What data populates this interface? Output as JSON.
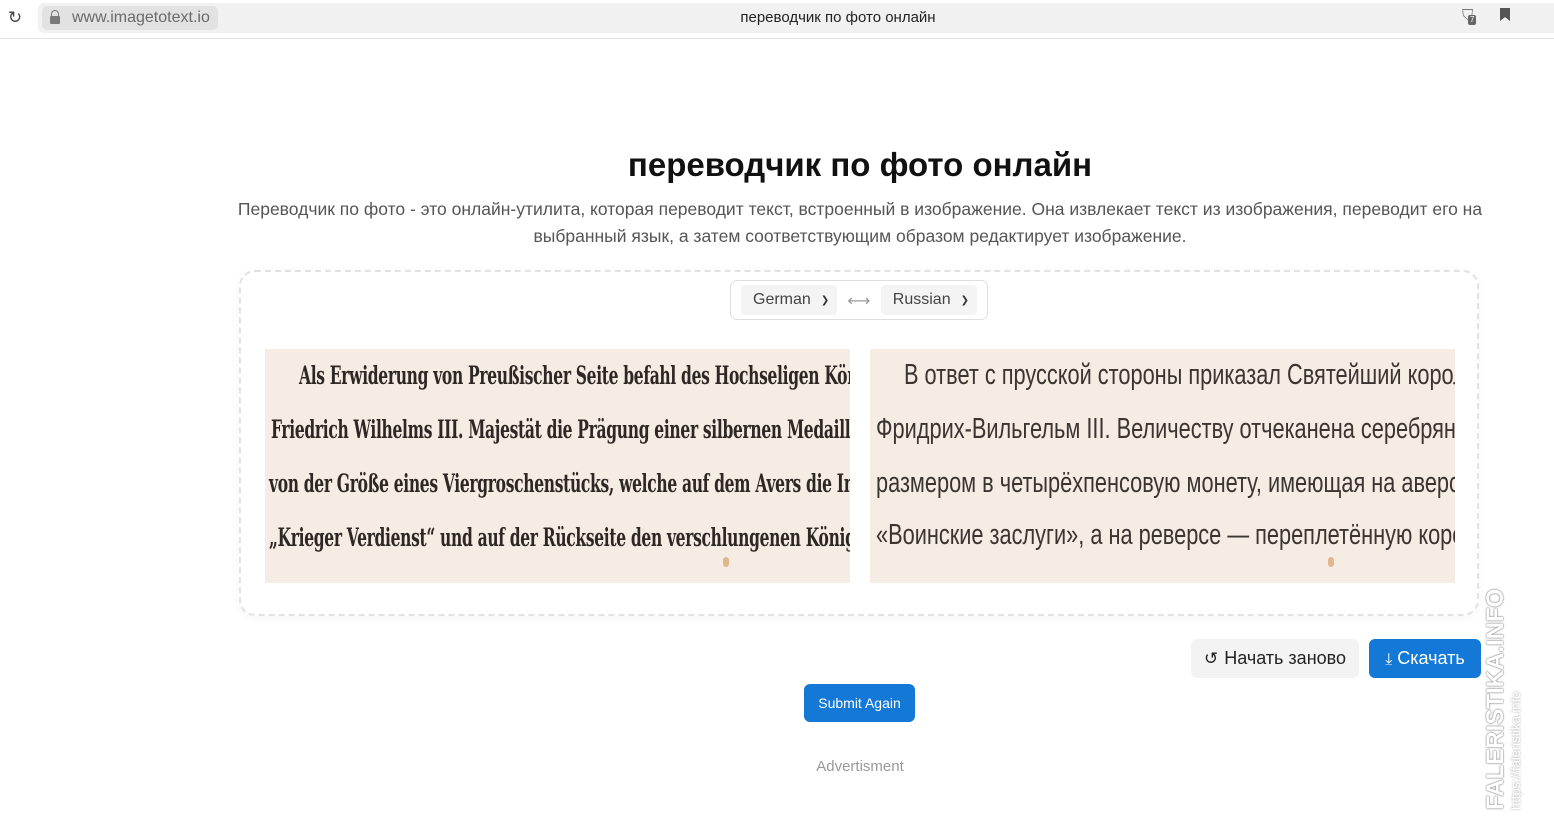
{
  "browser": {
    "url": "www.imagetotext.io",
    "tab_title": "переводчик по фото онлайн",
    "extension_badge": "7"
  },
  "page": {
    "title": "переводчик по фото онлайн",
    "description": "Переводчик по фото - это онлайн-утилита, которая переводит текст, встроенный в изображение. Она извлекает текст из изображения, переводит его на выбранный язык, а затем соответствующим образом редактирует изображение."
  },
  "translator": {
    "source_language": "German",
    "target_language": "Russian",
    "source_image_lines": [
      "Als Erwiderung von Preußischer Seite befahl des Hochseligen Königs",
      "Friedrich Wilhelms III. Majestät die Prägung einer silbernen Medaille",
      "von der Größe eines Viergroschenstücks, welche auf dem Avers die Inschrift:",
      "„Krieger Verdienst“ und auf der Rückseite den verschlungenen Königlichen"
    ],
    "translated_image_lines": [
      "В ответ с прусской стороны приказал Святейший король",
      "Фридрих-Вильгельм III. Величеству отчеканена серебряная медаль",
      "размером в четырёхпенсовую монету, имеющая на аверсе надпись:",
      "«Воинские заслуги», а на реверсе — переплетённую королевскую"
    ]
  },
  "actions": {
    "restart_label": "Начать заново",
    "download_label": "Скачать",
    "submit_again_label": "Submit Again"
  },
  "footer": {
    "advertisement_label": "Advertisment"
  },
  "watermark": {
    "main": "FALERISTIKA.INFO",
    "sub": "https://faleristika.info"
  },
  "colors": {
    "primary": "#1479d6",
    "image_paper": "#f5ece3"
  },
  "icons": {
    "reload": "reload-icon",
    "lock": "lock-icon",
    "swap": "swap-arrows-icon",
    "restart": "undo-icon",
    "download": "download-icon"
  }
}
